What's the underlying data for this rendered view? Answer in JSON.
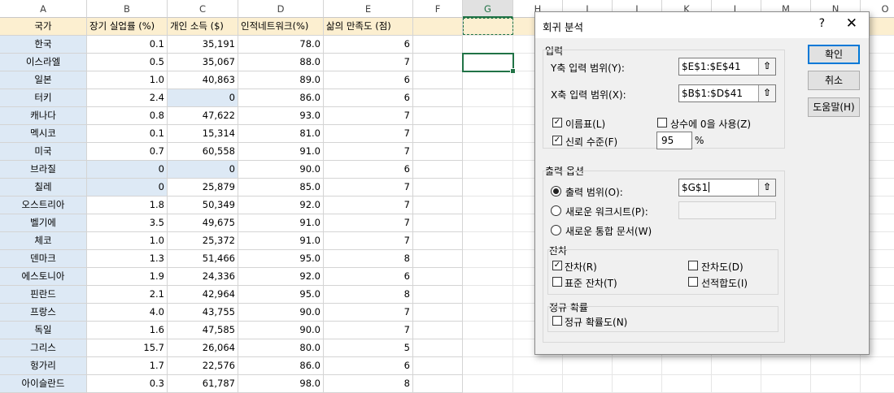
{
  "columns": [
    "A",
    "B",
    "C",
    "D",
    "E",
    "F",
    "G",
    "H",
    "I",
    "J",
    "K",
    "L",
    "M",
    "N",
    "O"
  ],
  "header_row": [
    "국가",
    "장기 실업률 (%)",
    "개인 소득 ($)",
    "인적네트워크(%)",
    "삶의 만족도 (점)"
  ],
  "rows": [
    [
      "한국",
      "0.1",
      "35,191",
      "78.0",
      "6"
    ],
    [
      "이스라엘",
      "0.5",
      "35,067",
      "88.0",
      "7"
    ],
    [
      "일본",
      "1.0",
      "40,863",
      "89.0",
      "6"
    ],
    [
      "터키",
      "2.4",
      "0",
      "86.0",
      "6"
    ],
    [
      "캐나다",
      "0.8",
      "47,622",
      "93.0",
      "7"
    ],
    [
      "멕시코",
      "0.1",
      "15,314",
      "81.0",
      "7"
    ],
    [
      "미국",
      "0.7",
      "60,558",
      "91.0",
      "7"
    ],
    [
      "브라질",
      "0",
      "0",
      "90.0",
      "6"
    ],
    [
      "칠레",
      "0",
      "25,879",
      "85.0",
      "7"
    ],
    [
      "오스트리아",
      "1.8",
      "50,349",
      "92.0",
      "7"
    ],
    [
      "벨기에",
      "3.5",
      "49,675",
      "91.0",
      "7"
    ],
    [
      "체코",
      "1.0",
      "25,372",
      "91.0",
      "7"
    ],
    [
      "덴마크",
      "1.3",
      "51,466",
      "95.0",
      "8"
    ],
    [
      "에스토니아",
      "1.9",
      "24,336",
      "92.0",
      "6"
    ],
    [
      "핀란드",
      "2.1",
      "42,964",
      "95.0",
      "8"
    ],
    [
      "프랑스",
      "4.0",
      "43,755",
      "90.0",
      "7"
    ],
    [
      "독일",
      "1.6",
      "47,585",
      "90.0",
      "7"
    ],
    [
      "그리스",
      "15.7",
      "26,064",
      "80.0",
      "5"
    ],
    [
      "헝가리",
      "1.7",
      "22,576",
      "86.0",
      "6"
    ],
    [
      "아이슬란드",
      "0.3",
      "61,787",
      "98.0",
      "8"
    ]
  ],
  "dialog": {
    "title": "회귀 분석",
    "help": "?",
    "close": "✕",
    "input_group": "입력",
    "y_range_label": "Y축 입력 범위(Y):",
    "y_range_value": "$E$1:$E$41",
    "x_range_label": "X축 입력 범위(X):",
    "x_range_value": "$B$1:$D$41",
    "labels_chk": "이름표(L)",
    "labels_checked": true,
    "const_zero_chk": "상수에 0을 사용(Z)",
    "const_zero_checked": false,
    "confidence_chk": "신뢰 수준(F)",
    "confidence_checked": true,
    "confidence_value": "95",
    "percent": "%",
    "output_group": "출력 옵션",
    "output_range_radio": "출력 범위(O):",
    "output_range_value": "$G$1",
    "new_sheet_radio": "새로운 워크시트(P):",
    "new_workbook_radio": "새로운 통합 문서(W)",
    "residual_group": "잔차",
    "residuals_chk": "잔차(R)",
    "residuals_checked": true,
    "std_residuals_chk": "표준 잔차(T)",
    "residual_plots_chk": "잔차도(D)",
    "line_fit_chk": "선적합도(I)",
    "normal_group": "정규 확률",
    "normal_plot_chk": "정규 확률도(N)",
    "ok_button": "확인",
    "cancel_button": "취소",
    "help_button": "도움말(H)",
    "ref_icon": "collapse-dialog-icon"
  },
  "colors": {
    "header_fill": "#fcefd0",
    "country_fill": "#dde9f5",
    "selection": "#217346",
    "default_button": "#0078d7"
  }
}
